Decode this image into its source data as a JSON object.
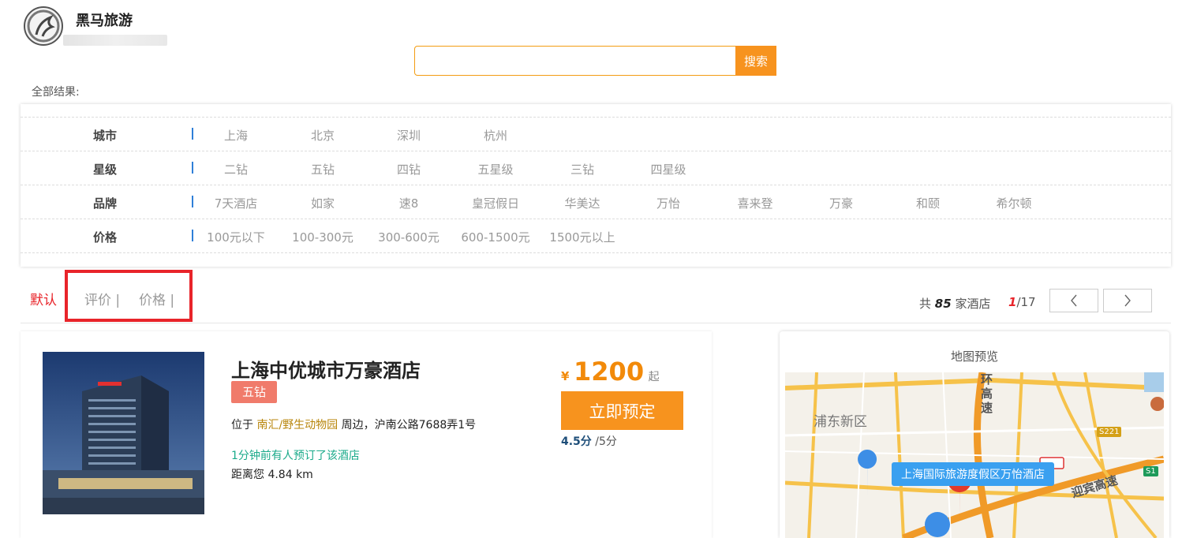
{
  "header": {
    "brand": "黑马旅游",
    "logo_icon": "horse-logo-icon"
  },
  "search": {
    "value": "",
    "placeholder": "",
    "button_label": "搜索"
  },
  "results": {
    "label": "全部结果:"
  },
  "filters": [
    {
      "label": "城市",
      "options": [
        "上海",
        "北京",
        "深圳",
        "杭州"
      ]
    },
    {
      "label": "星级",
      "options": [
        "二钻",
        "五钻",
        "四钻",
        "五星级",
        "三钻",
        "四星级"
      ]
    },
    {
      "label": "品牌",
      "options": [
        "7天酒店",
        "如家",
        "速8",
        "皇冠假日",
        "华美达",
        "万怡",
        "喜来登",
        "万豪",
        "和颐",
        "希尔顿"
      ]
    },
    {
      "label": "价格",
      "options": [
        "100元以下",
        "100-300元",
        "300-600元",
        "600-1500元",
        "1500元以上"
      ]
    }
  ],
  "sort": {
    "default_label": "默认",
    "rating_label": "评价 |",
    "price_label": "价格 |",
    "active_color": "#e8242a"
  },
  "pagination": {
    "total_prefix": "共",
    "total_count": "85",
    "total_suffix": "家酒店",
    "current_page": "1",
    "total_pages": "/17",
    "prev_icon": "chevron-left-icon",
    "next_icon": "chevron-right-icon"
  },
  "hotel": {
    "name": "上海中优城市万豪酒店",
    "star": "五钻",
    "location_prefix": "位于",
    "location_area": "南汇/野生动物园",
    "location_suffix": "周边，沪南公路7688弄1号",
    "booked_notice": "1分钟前有人预订了该酒店",
    "distance": "距离您 4.84 km",
    "currency": "¥",
    "price": "1200",
    "price_suffix": "起",
    "book_label": "立即预定",
    "score": "4.5分",
    "score_max": "/5分",
    "accent_color": "#f7931e"
  },
  "map": {
    "title": "地图预览",
    "district": "浦东新区",
    "road_ring": "环高速",
    "road_yingbin": "迎宾高速",
    "badge_s221": "S221",
    "badge_s1": "S1",
    "popup": "上海国际旅游度假区万怡酒店"
  }
}
